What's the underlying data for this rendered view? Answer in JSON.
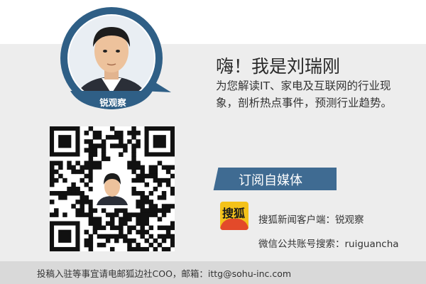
{
  "profile": {
    "label": "锐观察",
    "title": "嗨！我是刘瑞刚",
    "description": "为您解读IT、家电及互联网的行业现象，剖析热点事件，预测行业趋势。"
  },
  "subscribe": {
    "label": "订阅自媒体"
  },
  "channels": {
    "sohu_logo_text": "搜狐",
    "client_line": "搜狐新闻客户端：锐观察",
    "wechat_line": "微信公共账号搜索：ruiguancha"
  },
  "footer": {
    "text": "投稿入驻等事宜请电邮狐边社COO，邮箱：ittg@sohu-inc.com"
  },
  "colors": {
    "accent": "#3f6b92",
    "avatar_ring": "#2f5f86",
    "background": "#ededed",
    "footer": "#d9d9d9"
  },
  "icons": {
    "qr": "qr-code-icon",
    "sohu": "sohu-logo-icon"
  }
}
